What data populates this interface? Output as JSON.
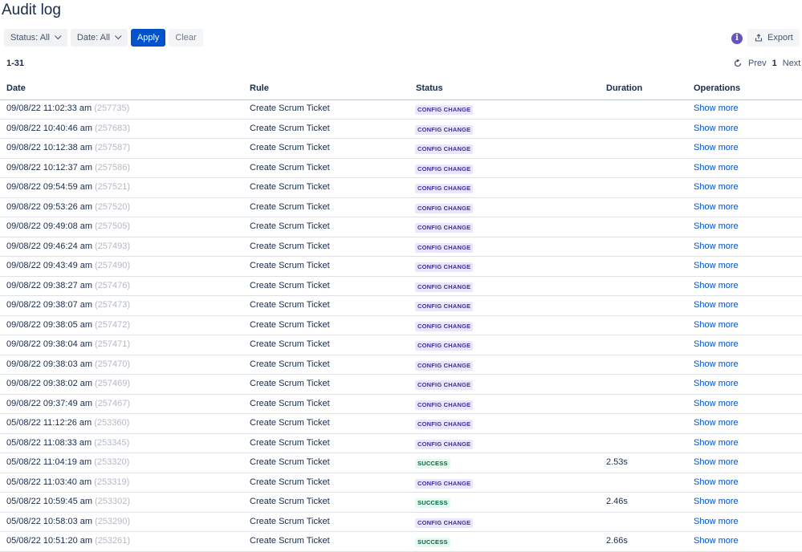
{
  "page": {
    "title": "Audit log"
  },
  "toolbar": {
    "status_filter": "Status: All",
    "date_filter": "Date: All",
    "apply_label": "Apply",
    "clear_label": "Clear",
    "export_label": "Export",
    "info_glyph": "i"
  },
  "pagination": {
    "range": "1-31",
    "prev_label": "Prev",
    "current_page": "1",
    "next_label": "Next"
  },
  "table": {
    "columns": [
      "Date",
      "Rule",
      "Status",
      "Duration",
      "Operations"
    ],
    "rows": [
      {
        "date": "09/08/22 11:02:33 am",
        "id": "(257735)",
        "rule": "Create Scrum Ticket",
        "status": "CONFIG CHANGE",
        "duration": "",
        "op": "Show more"
      },
      {
        "date": "09/08/22 10:40:46 am",
        "id": "(257683)",
        "rule": "Create Scrum Ticket",
        "status": "CONFIG CHANGE",
        "duration": "",
        "op": "Show more"
      },
      {
        "date": "09/08/22 10:12:38 am",
        "id": "(257587)",
        "rule": "Create Scrum Ticket",
        "status": "CONFIG CHANGE",
        "duration": "",
        "op": "Show more"
      },
      {
        "date": "09/08/22 10:12:37 am",
        "id": "(257586)",
        "rule": "Create Scrum Ticket",
        "status": "CONFIG CHANGE",
        "duration": "",
        "op": "Show more"
      },
      {
        "date": "09/08/22 09:54:59 am",
        "id": "(257521)",
        "rule": "Create Scrum Ticket",
        "status": "CONFIG CHANGE",
        "duration": "",
        "op": "Show more"
      },
      {
        "date": "09/08/22 09:53:26 am",
        "id": "(257520)",
        "rule": "Create Scrum Ticket",
        "status": "CONFIG CHANGE",
        "duration": "",
        "op": "Show more"
      },
      {
        "date": "09/08/22 09:49:08 am",
        "id": "(257505)",
        "rule": "Create Scrum Ticket",
        "status": "CONFIG CHANGE",
        "duration": "",
        "op": "Show more"
      },
      {
        "date": "09/08/22 09:46:24 am",
        "id": "(257493)",
        "rule": "Create Scrum Ticket",
        "status": "CONFIG CHANGE",
        "duration": "",
        "op": "Show more"
      },
      {
        "date": "09/08/22 09:43:49 am",
        "id": "(257490)",
        "rule": "Create Scrum Ticket",
        "status": "CONFIG CHANGE",
        "duration": "",
        "op": "Show more"
      },
      {
        "date": "09/08/22 09:38:27 am",
        "id": "(257476)",
        "rule": "Create Scrum Ticket",
        "status": "CONFIG CHANGE",
        "duration": "",
        "op": "Show more"
      },
      {
        "date": "09/08/22 09:38:07 am",
        "id": "(257473)",
        "rule": "Create Scrum Ticket",
        "status": "CONFIG CHANGE",
        "duration": "",
        "op": "Show more"
      },
      {
        "date": "09/08/22 09:38:05 am",
        "id": "(257472)",
        "rule": "Create Scrum Ticket",
        "status": "CONFIG CHANGE",
        "duration": "",
        "op": "Show more"
      },
      {
        "date": "09/08/22 09:38:04 am",
        "id": "(257471)",
        "rule": "Create Scrum Ticket",
        "status": "CONFIG CHANGE",
        "duration": "",
        "op": "Show more"
      },
      {
        "date": "09/08/22 09:38:03 am",
        "id": "(257470)",
        "rule": "Create Scrum Ticket",
        "status": "CONFIG CHANGE",
        "duration": "",
        "op": "Show more"
      },
      {
        "date": "09/08/22 09:38:02 am",
        "id": "(257469)",
        "rule": "Create Scrum Ticket",
        "status": "CONFIG CHANGE",
        "duration": "",
        "op": "Show more"
      },
      {
        "date": "09/08/22 09:37:49 am",
        "id": "(257467)",
        "rule": "Create Scrum Ticket",
        "status": "CONFIG CHANGE",
        "duration": "",
        "op": "Show more"
      },
      {
        "date": "05/08/22 11:12:26 am",
        "id": "(253360)",
        "rule": "Create Scrum Ticket",
        "status": "CONFIG CHANGE",
        "duration": "",
        "op": "Show more"
      },
      {
        "date": "05/08/22 11:08:33 am",
        "id": "(253345)",
        "rule": "Create Scrum Ticket",
        "status": "CONFIG CHANGE",
        "duration": "",
        "op": "Show more"
      },
      {
        "date": "05/08/22 11:04:19 am",
        "id": "(253320)",
        "rule": "Create Scrum Ticket",
        "status": "SUCCESS",
        "duration": "2.53s",
        "op": "Show more"
      },
      {
        "date": "05/08/22 11:03:40 am",
        "id": "(253319)",
        "rule": "Create Scrum Ticket",
        "status": "CONFIG CHANGE",
        "duration": "",
        "op": "Show more"
      },
      {
        "date": "05/08/22 10:59:45 am",
        "id": "(253302)",
        "rule": "Create Scrum Ticket",
        "status": "SUCCESS",
        "duration": "2.46s",
        "op": "Show more"
      },
      {
        "date": "05/08/22 10:58:03 am",
        "id": "(253290)",
        "rule": "Create Scrum Ticket",
        "status": "CONFIG CHANGE",
        "duration": "",
        "op": "Show more"
      },
      {
        "date": "05/08/22 10:51:20 am",
        "id": "(253261)",
        "rule": "Create Scrum Ticket",
        "status": "SUCCESS",
        "duration": "2.66s",
        "op": "Show more"
      }
    ]
  },
  "colors": {
    "primary": "#0052cc",
    "config_change_bg": "#eae6ff",
    "config_change_fg": "#403294",
    "success_bg": "#e3fcef",
    "success_fg": "#006644",
    "info_icon": "#6554c0"
  }
}
